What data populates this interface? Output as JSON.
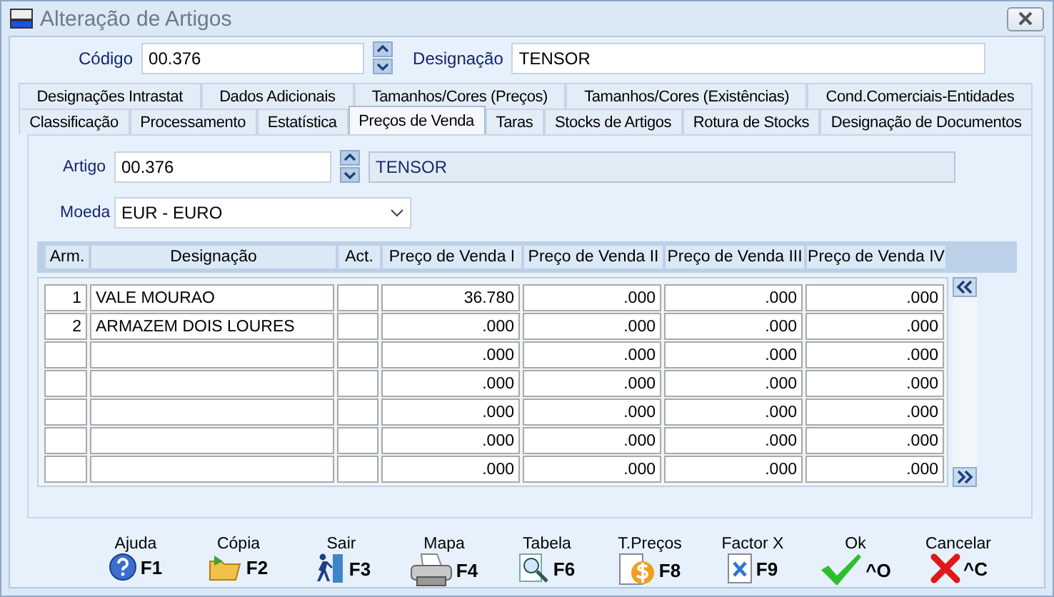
{
  "window": {
    "title": "Alteração de Artigos"
  },
  "header": {
    "code_label": "Código",
    "code_value": "00.376",
    "designation_label": "Designação",
    "designation_value": "TENSOR"
  },
  "tab_rows": [
    [
      {
        "label": "Designações Intrastat",
        "selected": false
      },
      {
        "label": "Dados Adicionais",
        "selected": false
      },
      {
        "label": "Tamanhos/Cores (Preços)",
        "selected": false
      },
      {
        "label": "Tamanhos/Cores (Existências)",
        "selected": false
      },
      {
        "label": "Cond.Comerciais-Entidades",
        "selected": false
      }
    ],
    [
      {
        "label": "Classificação",
        "selected": false
      },
      {
        "label": "Processamento",
        "selected": false
      },
      {
        "label": "Estatística",
        "selected": false
      },
      {
        "label": "Preços de Venda",
        "selected": true
      },
      {
        "label": "Taras",
        "selected": false
      },
      {
        "label": "Stocks de Artigos",
        "selected": false
      },
      {
        "label": "Rotura de Stocks",
        "selected": false
      },
      {
        "label": "Designação de Documentos",
        "selected": false
      }
    ]
  ],
  "article": {
    "label": "Artigo",
    "code": "00.376",
    "name": "TENSOR"
  },
  "currency": {
    "label": "Moeda",
    "value": "EUR - EURO"
  },
  "table": {
    "columns": [
      "Arm.",
      "Designação",
      "Act.",
      "Preço de Venda I",
      "Preço de Venda II",
      "Preço de Venda III",
      "Preço de Venda IV"
    ],
    "rows": [
      [
        "1",
        "VALE MOURAO",
        "",
        "36.780",
        ".000",
        ".000",
        ".000"
      ],
      [
        "2",
        "ARMAZEM DOIS LOURES",
        "",
        ".000",
        ".000",
        ".000",
        ".000"
      ],
      [
        "",
        "",
        "",
        ".000",
        ".000",
        ".000",
        ".000"
      ],
      [
        "",
        "",
        "",
        ".000",
        ".000",
        ".000",
        ".000"
      ],
      [
        "",
        "",
        "",
        ".000",
        ".000",
        ".000",
        ".000"
      ],
      [
        "",
        "",
        "",
        ".000",
        ".000",
        ".000",
        ".000"
      ],
      [
        "",
        "",
        "",
        ".000",
        ".000",
        ".000",
        ".000"
      ]
    ]
  },
  "toolbar": [
    {
      "kind": "help",
      "label": "Ajuda",
      "key": "F1"
    },
    {
      "kind": "copy",
      "label": "Cópia",
      "key": "F2"
    },
    {
      "kind": "exit",
      "label": "Sair",
      "key": "F3"
    },
    {
      "kind": "print",
      "label": "Mapa",
      "key": "F4"
    },
    {
      "kind": "table",
      "label": "Tabela",
      "key": "F6"
    },
    {
      "kind": "prices",
      "label": "T.Preços",
      "key": "F8"
    },
    {
      "kind": "factor",
      "label": "Factor X",
      "key": "F9"
    },
    {
      "kind": "ok",
      "label": "Ok",
      "key": "^O"
    },
    {
      "kind": "cancel",
      "label": "Cancelar",
      "key": "^C"
    }
  ]
}
